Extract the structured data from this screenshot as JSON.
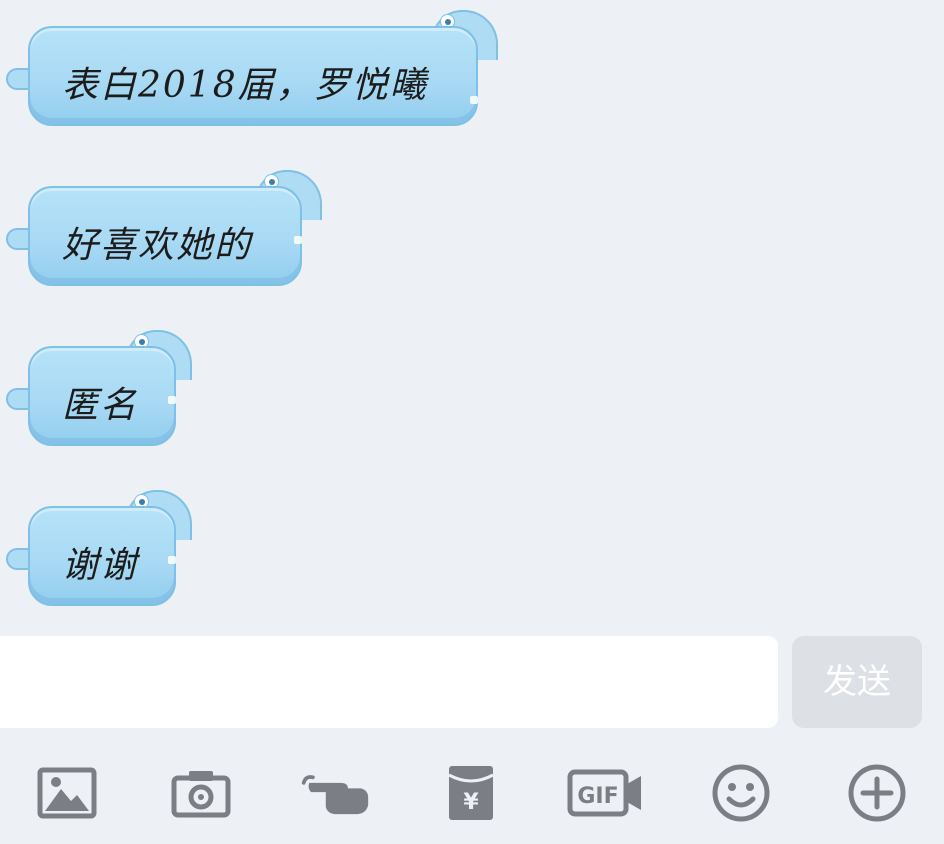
{
  "messages": [
    {
      "text": "表白2018届，罗悦曦"
    },
    {
      "text": "好喜欢她的"
    },
    {
      "text": "匿名"
    },
    {
      "text": "谢谢"
    }
  ],
  "composer": {
    "input_value": "",
    "input_placeholder": "",
    "send_label": "发送"
  },
  "toolbar": {
    "icons": [
      "image-icon",
      "camera-icon",
      "poke-icon",
      "red-packet-icon",
      "gif-icon",
      "emoji-icon",
      "plus-icon"
    ],
    "red_packet_symbol": "¥",
    "gif_label": "GIF"
  },
  "colors": {
    "background": "#edf0f5",
    "bubble": "#aedcf5",
    "bubble_border": "#7fc0e6",
    "send_disabled": "#dde0e5",
    "icon": "#7b7f85"
  }
}
